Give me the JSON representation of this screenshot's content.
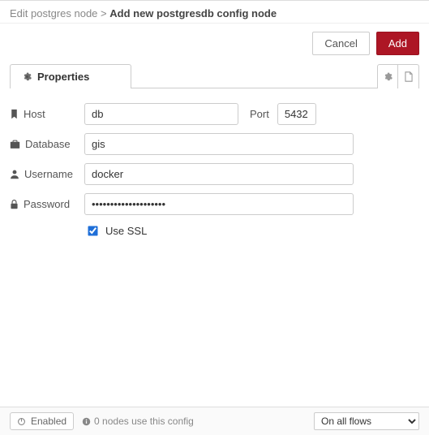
{
  "header": {
    "breadcrumb_prev": "Edit postgres node",
    "separator": ">",
    "breadcrumb_current": "Add new postgresdb config node"
  },
  "actions": {
    "cancel": "Cancel",
    "add": "Add"
  },
  "tabs": {
    "properties": "Properties"
  },
  "labels": {
    "host": "Host",
    "port": "Port",
    "database": "Database",
    "username": "Username",
    "password": "Password",
    "use_ssl": "Use SSL"
  },
  "values": {
    "host": "db",
    "port": "5432",
    "database": "gis",
    "username": "docker",
    "password": "••••••••••••••••••••",
    "use_ssl": true
  },
  "footer": {
    "enabled_label": "Enabled",
    "usage_text": "0 nodes use this config",
    "scope_selected": "On all flows"
  }
}
